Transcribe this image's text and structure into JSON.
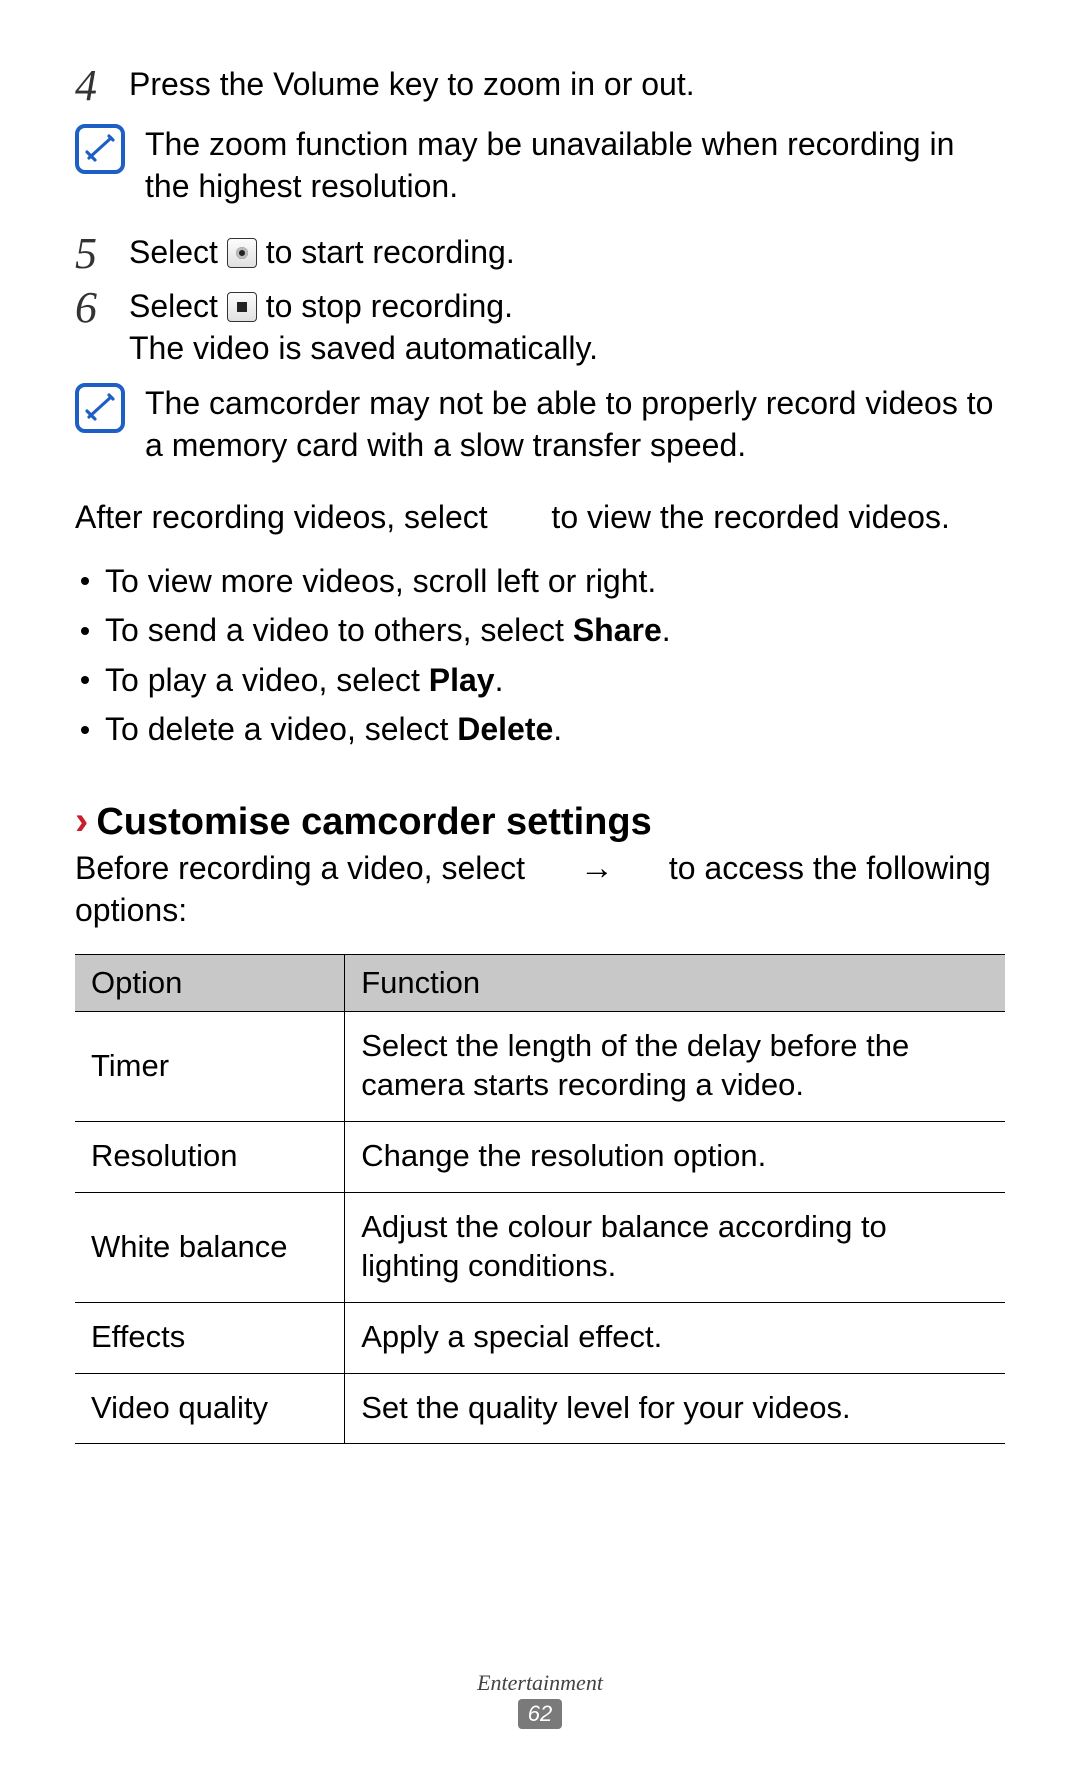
{
  "steps": {
    "s4": {
      "num": "4",
      "text": "Press the Volume key to zoom in or out."
    },
    "s5": {
      "num": "5",
      "pre": "Select ",
      "post": " to start recording."
    },
    "s6": {
      "num": "6",
      "pre": "Select ",
      "post": " to stop recording.",
      "line2": "The video is saved automatically."
    }
  },
  "notes": {
    "n1": "The zoom function may be unavailable when recording in the highest resolution.",
    "n2": "The camcorder may not be able to properly record videos to a memory card with a slow transfer speed."
  },
  "after_para": {
    "pre": "After recording videos, select ",
    "post": " to view the recorded videos."
  },
  "bullets": {
    "b1": "To view more videos, scroll left or right.",
    "b2": {
      "pre": "To send a video to others, select ",
      "bold": "Share",
      "post": "."
    },
    "b3": {
      "pre": "To play a video, select ",
      "bold": "Play",
      "post": "."
    },
    "b4": {
      "pre": "To delete a video, select ",
      "bold": "Delete",
      "post": "."
    }
  },
  "subhead": {
    "chev": "›",
    "text": "Customise camcorder settings"
  },
  "intro2": {
    "pre": "Before recording a video, select ",
    "arrow": "→",
    "post": " to access the following options:"
  },
  "table": {
    "head": {
      "c1": "Option",
      "c2": "Function"
    },
    "rows": [
      {
        "c1": "Timer",
        "c2": "Select the length of the delay before the camera starts recording a video."
      },
      {
        "c1": "Resolution",
        "c2": "Change the resolution option."
      },
      {
        "c1": "White balance",
        "c2": "Adjust the colour balance according to lighting conditions."
      },
      {
        "c1": "Effects",
        "c2": "Apply a special effect."
      },
      {
        "c1": "Video quality",
        "c2": "Set the quality level for your videos."
      }
    ]
  },
  "footer": {
    "section": "Entertainment",
    "page": "62"
  }
}
